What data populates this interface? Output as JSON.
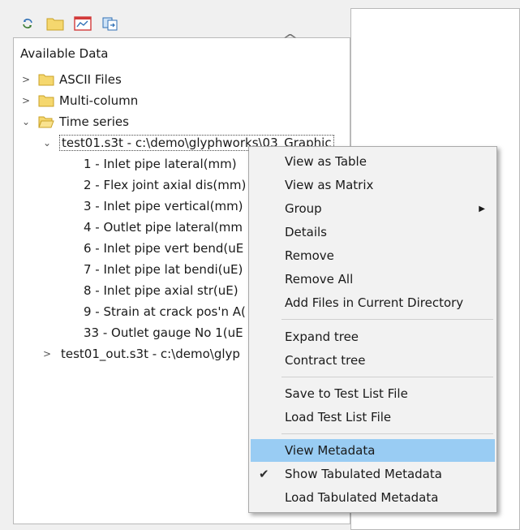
{
  "tree": {
    "title": "Available Data",
    "folders": [
      {
        "label": "ASCII Files",
        "expanded": false
      },
      {
        "label": "Multi-column",
        "expanded": false
      },
      {
        "label": "Time series",
        "expanded": true
      }
    ],
    "file1": {
      "label": "test01.s3t - c:\\demo\\glyphworks\\03_Graphic",
      "expanded": true
    },
    "channels": [
      "1 - Inlet pipe lateral(mm)",
      "2 - Flex joint axial dis(mm)",
      "3 - Inlet pipe vertical(mm)",
      "4 - Outlet pipe lateral(mm",
      "6 - Inlet pipe vert bend(uE",
      "7 - Inlet pipe lat bendi(uE)",
      "8 - Inlet pipe axial str(uE)",
      "9 - Strain at crack pos'n A(",
      "33 - Outlet gauge No 1(uE"
    ],
    "file2": {
      "label": "test01_out.s3t - c:\\demo\\glyp",
      "expanded": false
    }
  },
  "menu": {
    "items": [
      {
        "label": "View as Table"
      },
      {
        "label": "View as Matrix"
      },
      {
        "label": "Group",
        "submenu": true
      },
      {
        "label": "Details"
      },
      {
        "label": "Remove"
      },
      {
        "label": "Remove All"
      },
      {
        "label": "Add Files in Current Directory"
      },
      {
        "label": "Expand tree"
      },
      {
        "label": "Contract tree"
      },
      {
        "label": "Save to Test List File"
      },
      {
        "label": "Load Test List File"
      },
      {
        "label": "View Metadata",
        "highlighted": true
      },
      {
        "label": "Show Tabulated Metadata",
        "checked": true
      },
      {
        "label": "Load Tabulated Metadata"
      }
    ]
  },
  "colors": {
    "highlight": "#99ccf3",
    "folder": "#f5d76e",
    "folder_border": "#c9a227"
  }
}
